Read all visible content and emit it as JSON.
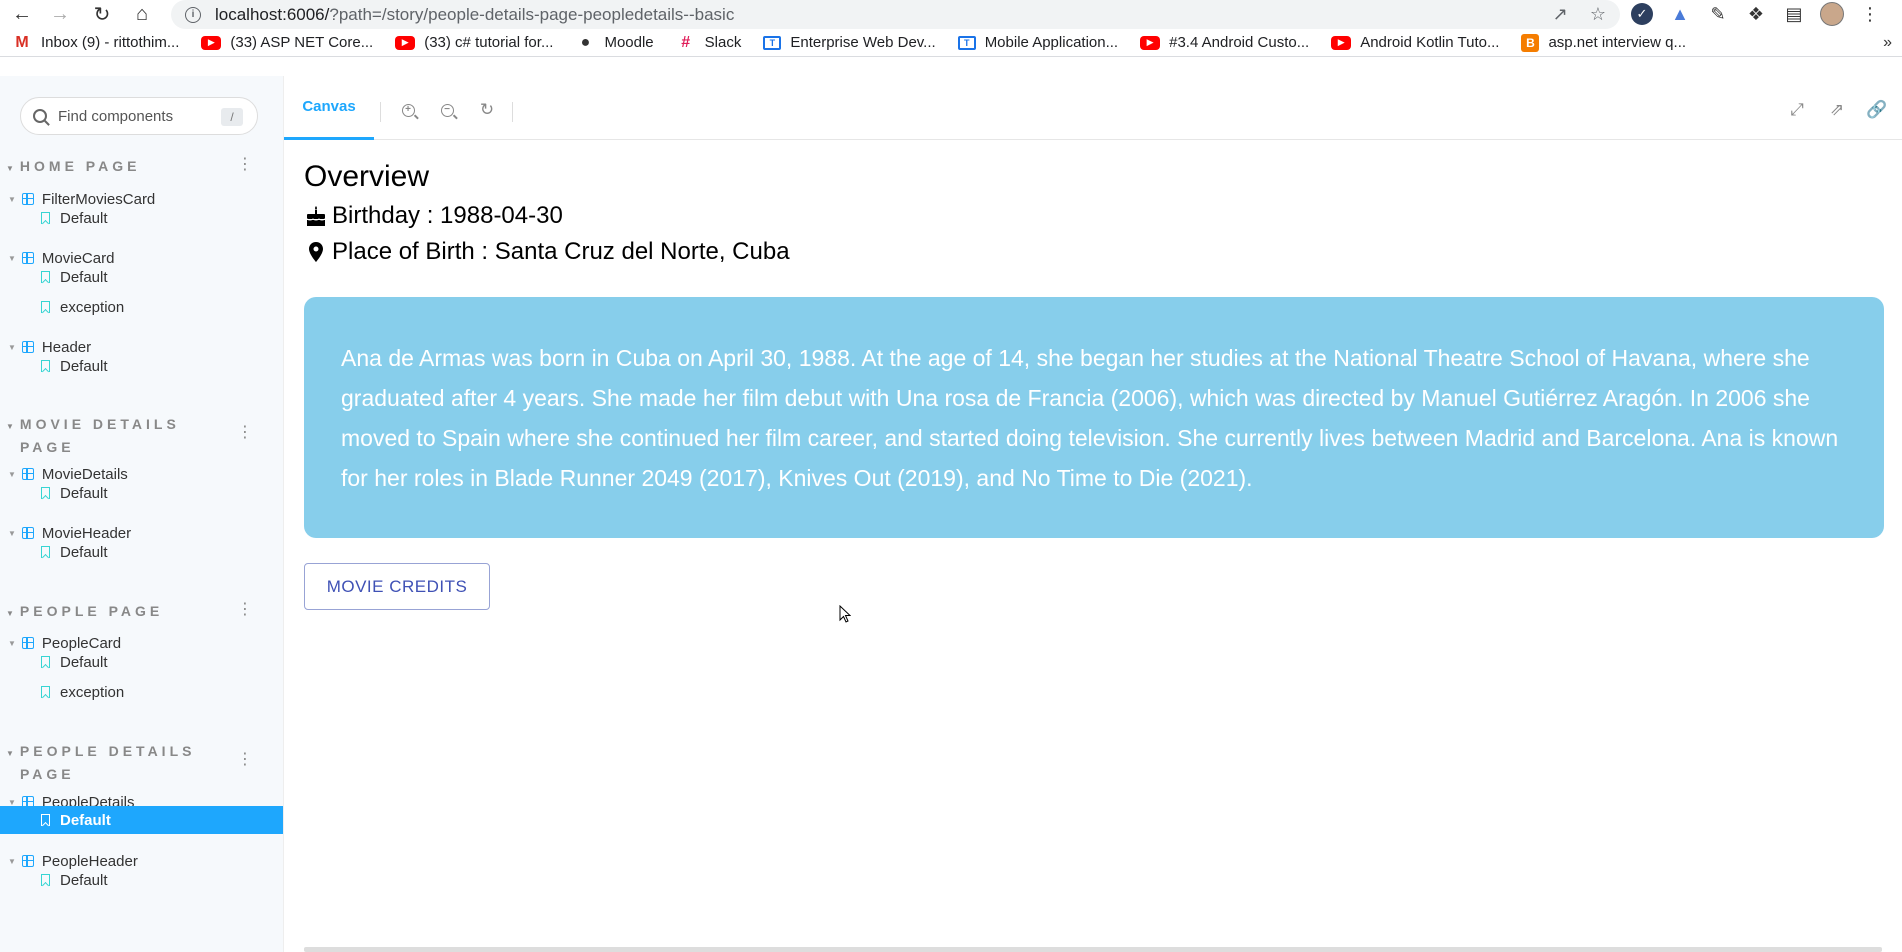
{
  "browser": {
    "url_host": "localhost:6006/",
    "url_path": "?path=/story/people-details-page-peopledetails--basic"
  },
  "bookmarks": [
    {
      "label": "Inbox (9) - rittothim...",
      "icon": "gmail-icon"
    },
    {
      "label": "(33) ASP NET Core...",
      "icon": "youtube-icon"
    },
    {
      "label": "(33) c# tutorial for...",
      "icon": "youtube-icon"
    },
    {
      "label": "Moodle",
      "icon": "globe-icon"
    },
    {
      "label": "Slack",
      "icon": "slack-icon"
    },
    {
      "label": "Enterprise Web Dev...",
      "icon": "t-icon"
    },
    {
      "label": "Mobile Application...",
      "icon": "t-icon"
    },
    {
      "label": "#3.4 Android Custo...",
      "icon": "youtube-icon"
    },
    {
      "label": "Android Kotlin Tuto...",
      "icon": "youtube-icon"
    },
    {
      "label": "asp.net interview q...",
      "icon": "blogger-icon"
    }
  ],
  "sidebar": {
    "search_placeholder": "Find components",
    "search_shortcut": "/",
    "groups": [
      {
        "title": "HOME PAGE",
        "components": [
          {
            "name": "FilterMoviesCard",
            "stories": [
              "Default"
            ]
          },
          {
            "name": "MovieCard",
            "stories": [
              "Default",
              "exception"
            ]
          },
          {
            "name": "Header",
            "stories": [
              "Default"
            ]
          }
        ]
      },
      {
        "title_line1": "MOVIE DETAILS",
        "title_line2": "PAGE",
        "components": [
          {
            "name": "MovieDetails",
            "stories": [
              "Default"
            ]
          },
          {
            "name": "MovieHeader",
            "stories": [
              "Default"
            ]
          }
        ]
      },
      {
        "title": "PEOPLE PAGE",
        "components": [
          {
            "name": "PeopleCard",
            "stories": [
              "Default",
              "exception"
            ]
          }
        ]
      },
      {
        "title_line1": "PEOPLE DETAILS",
        "title_line2": "PAGE",
        "components": [
          {
            "name": "PeopleDetails",
            "stories": [
              "Default"
            ]
          },
          {
            "name": "PeopleHeader",
            "stories": [
              "Default"
            ]
          }
        ]
      }
    ]
  },
  "toolbar": {
    "canvas_tab": "Canvas"
  },
  "content": {
    "heading": "Overview",
    "birthday": "Birthday : 1988-04-30",
    "place_of_birth": "Place of Birth : Santa Cruz del Norte, Cuba",
    "biography": "Ana de Armas was born in Cuba on April 30, 1988. At the age of 14, she began her studies at the National Theatre School of Havana, where she graduated after 4 years. She made her film debut with Una rosa de Francia (2006), which was directed by Manuel Gutiérrez Aragón. In 2006 she moved to Spain where she continued her film career, and started doing television. She currently lives between Madrid and Barcelona. Ana is known for her roles in Blade Runner 2049 (2017), Knives Out (2019), and No Time to Die (2021).",
    "bio_bg_color": "#87ceeb",
    "credits_button": "MOVIE CREDITS"
  },
  "colors": {
    "accent": "#1ea7fd",
    "story_icon": "#37d5d3",
    "button_text": "#3f51b5"
  }
}
